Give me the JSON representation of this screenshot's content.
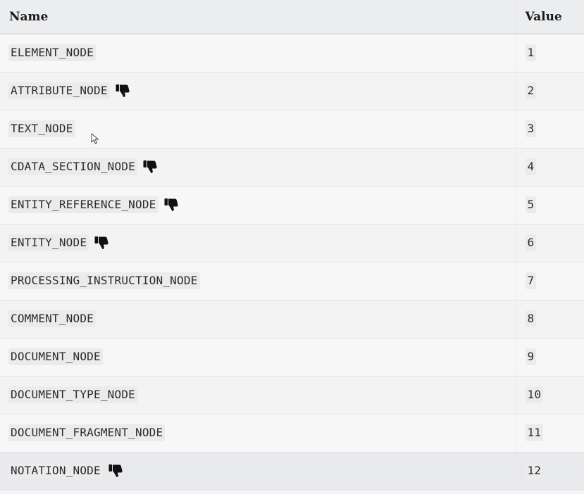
{
  "table": {
    "headers": {
      "name": "Name",
      "value": "Value"
    },
    "rows": [
      {
        "name": "ELEMENT_NODE",
        "value": "1",
        "deprecated": false
      },
      {
        "name": "ATTRIBUTE_NODE",
        "value": "2",
        "deprecated": true
      },
      {
        "name": "TEXT_NODE",
        "value": "3",
        "deprecated": false
      },
      {
        "name": "CDATA_SECTION_NODE",
        "value": "4",
        "deprecated": true
      },
      {
        "name": "ENTITY_REFERENCE_NODE",
        "value": "5",
        "deprecated": true
      },
      {
        "name": "ENTITY_NODE",
        "value": "6",
        "deprecated": true
      },
      {
        "name": "PROCESSING_INSTRUCTION_NODE",
        "value": "7",
        "deprecated": false
      },
      {
        "name": "COMMENT_NODE",
        "value": "8",
        "deprecated": false
      },
      {
        "name": "DOCUMENT_NODE",
        "value": "9",
        "deprecated": false
      },
      {
        "name": "DOCUMENT_TYPE_NODE",
        "value": "10",
        "deprecated": false
      },
      {
        "name": "DOCUMENT_FRAGMENT_NODE",
        "value": "11",
        "deprecated": false
      },
      {
        "name": "NOTATION_NODE",
        "value": "12",
        "deprecated": true
      }
    ]
  },
  "icons": {
    "deprecated": "thumbs-down-icon",
    "pointer": "mouse-cursor-icon"
  }
}
